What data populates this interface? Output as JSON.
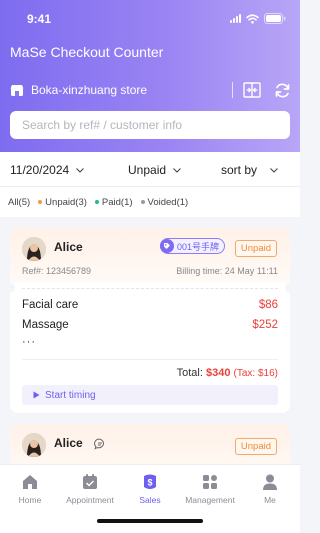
{
  "status_bar": {
    "time": "9:41"
  },
  "app": {
    "title": "MaSe Checkout Counter",
    "store_name": "Boka-xinzhuang store"
  },
  "icons": {
    "store": "store-icon",
    "scan": "scan-icon",
    "refresh": "refresh-icon",
    "chevron": "chevron-down-icon",
    "play": "play-icon",
    "chat": "chat-icon",
    "tag": "tag-icon"
  },
  "search": {
    "placeholder": "Search by ref# / customer info"
  },
  "filters": {
    "date": "11/20/2024",
    "status": "Unpaid",
    "sort": "sort by"
  },
  "status_tabs": [
    {
      "label": "All(5)",
      "color": ""
    },
    {
      "label": "Unpaid(3)",
      "color": "#f59a3d"
    },
    {
      "label": "Paid(1)",
      "color": "#1fbf75"
    },
    {
      "label": "Voided(1)",
      "color": "#9a9aa5"
    }
  ],
  "orders": [
    {
      "customer": "Alice",
      "tag": "001号手牌",
      "status": "Unpaid",
      "ref": "Ref#: 123456789",
      "billing_time": "Billing time: 24 May 11:11",
      "services": [
        {
          "name": "Facial care",
          "price": "$86"
        },
        {
          "name": "Massage",
          "price": "$252"
        }
      ],
      "more": "···",
      "total_label": "Total:",
      "total_amount": "$340",
      "tax": "(Tax: $16)",
      "action": "Start timing"
    },
    {
      "customer": "Alice",
      "status": "Unpaid"
    }
  ],
  "tabbar": [
    {
      "label": "Home",
      "icon": "home-icon",
      "active": false
    },
    {
      "label": "Appointment",
      "icon": "calendar-icon",
      "active": false
    },
    {
      "label": "Sales",
      "icon": "sales-icon",
      "active": true
    },
    {
      "label": "Management",
      "icon": "grid-icon",
      "active": false
    },
    {
      "label": "Me",
      "icon": "user-icon",
      "active": false
    }
  ],
  "colors": {
    "accent": "#6d5ff0",
    "header_start": "#7e6cf0",
    "header_end": "#b8a6f7",
    "price": "#e9413b",
    "unpaid": "#ee8c3a"
  }
}
